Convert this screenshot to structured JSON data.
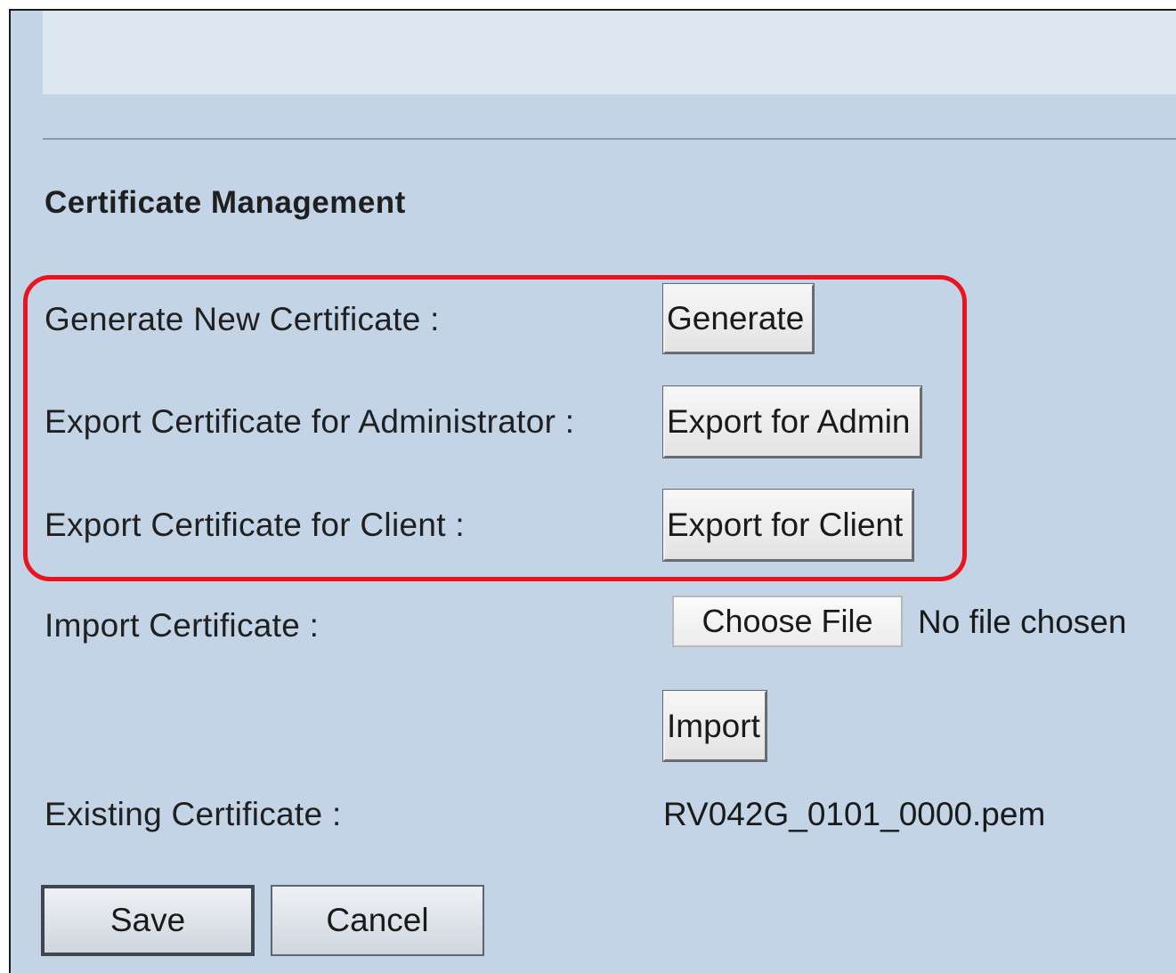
{
  "section": {
    "title": "Certificate Management"
  },
  "rows": {
    "generate": {
      "label": "Generate New Certificate :",
      "button": "Generate"
    },
    "export_admin": {
      "label": "Export Certificate for Administrator :",
      "button": "Export for Admin"
    },
    "export_client": {
      "label": "Export Certificate for Client :",
      "button": "Export for Client"
    },
    "import": {
      "label": "Import Certificate :",
      "choose_file": "Choose File",
      "file_status": "No file chosen",
      "button": "Import"
    },
    "existing": {
      "label": "Existing Certificate :",
      "value": "RV042G_0101_0000.pem"
    }
  },
  "footer": {
    "save": "Save",
    "cancel": "Cancel"
  },
  "colors": {
    "panel_background": "#c3d4e6",
    "highlight_border": "#e8141f"
  }
}
